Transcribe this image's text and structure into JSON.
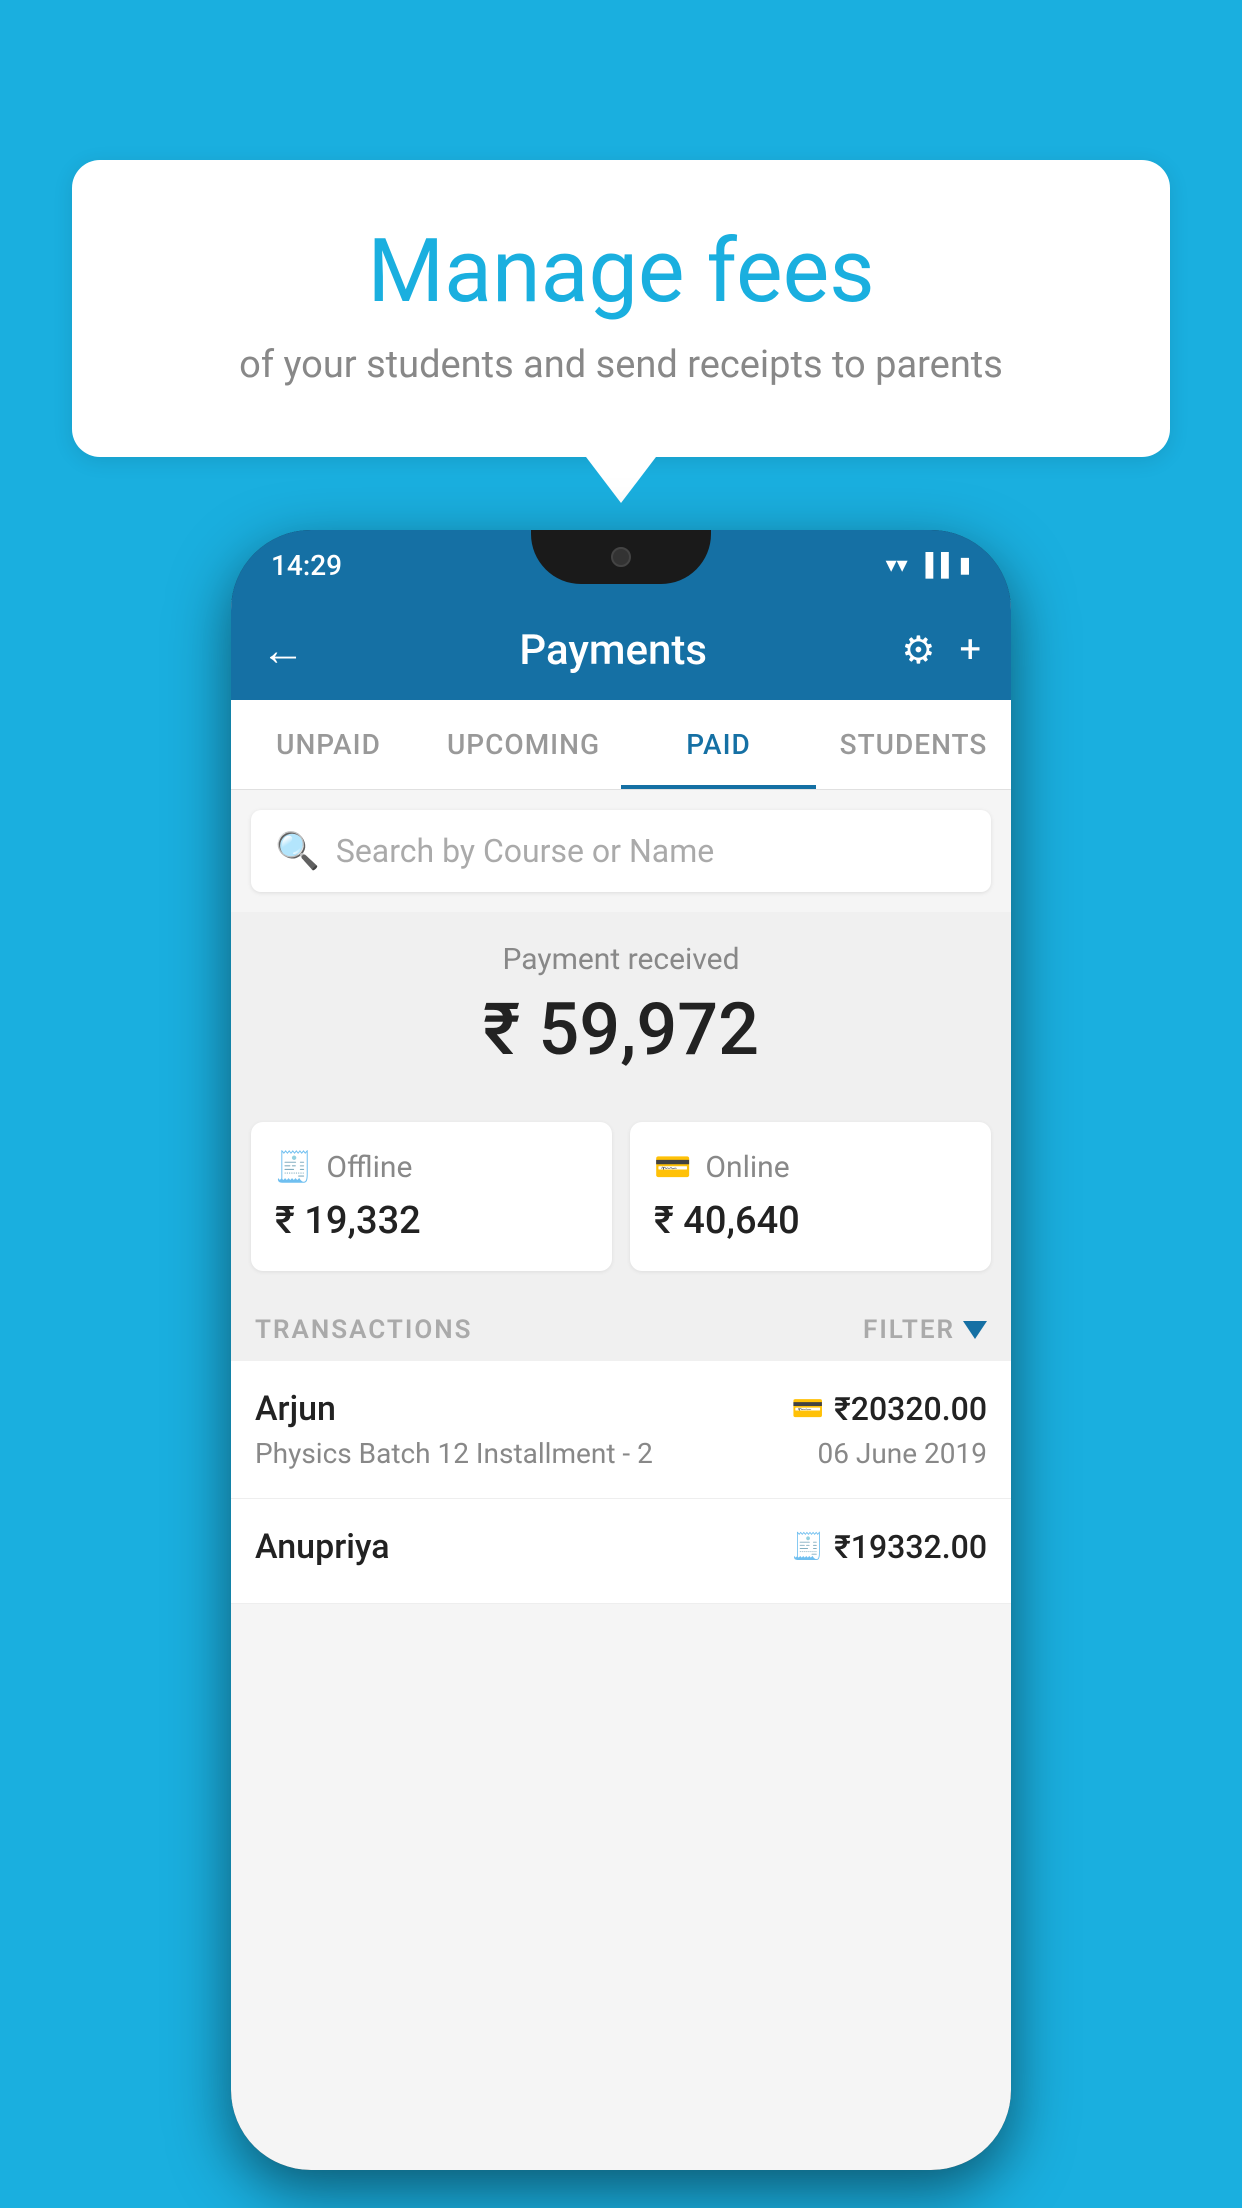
{
  "background_color": "#1AAFDF",
  "bubble": {
    "title": "Manage fees",
    "subtitle": "of your students and send receipts to parents"
  },
  "phone": {
    "time": "14:29",
    "app_bar": {
      "title": "Payments",
      "back_icon": "←",
      "gear_icon": "⚙",
      "plus_icon": "+"
    },
    "tabs": [
      {
        "label": "UNPAID",
        "active": false
      },
      {
        "label": "UPCOMING",
        "active": false
      },
      {
        "label": "PAID",
        "active": true
      },
      {
        "label": "STUDENTS",
        "active": false
      }
    ],
    "search": {
      "placeholder": "Search by Course or Name"
    },
    "payment_received": {
      "label": "Payment received",
      "amount": "₹ 59,972"
    },
    "offline_card": {
      "label": "Offline",
      "amount": "₹ 19,332"
    },
    "online_card": {
      "label": "Online",
      "amount": "₹ 40,640"
    },
    "transactions_label": "TRANSACTIONS",
    "filter_label": "FILTER",
    "transactions": [
      {
        "name": "Arjun",
        "amount": "₹20320.00",
        "course": "Physics Batch 12 Installment - 2",
        "date": "06 June 2019",
        "payment_type": "card"
      },
      {
        "name": "Anupriya",
        "amount": "₹19332.00",
        "course": "",
        "date": "",
        "payment_type": "offline"
      }
    ]
  }
}
